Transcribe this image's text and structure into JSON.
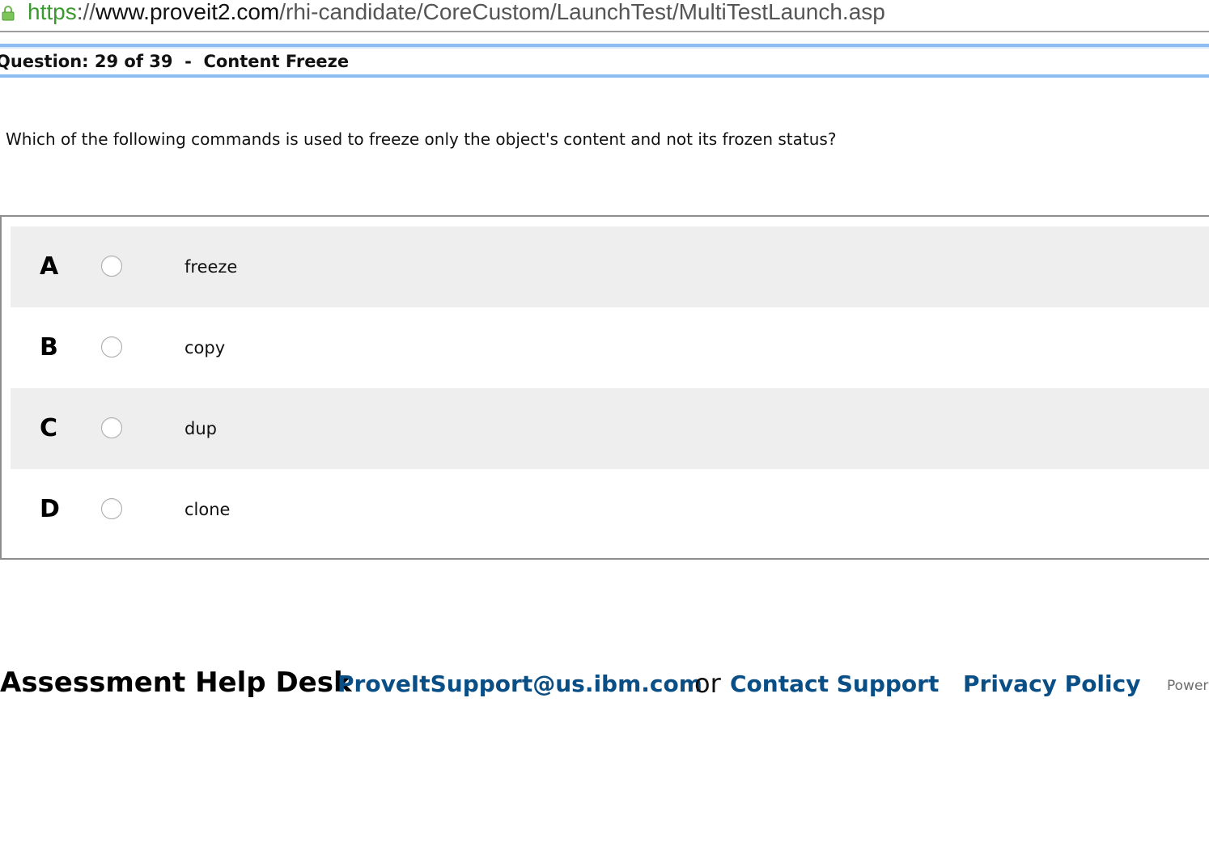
{
  "browser": {
    "url_scheme": "https",
    "url_separator": "://",
    "url_host": "www.proveit2.com",
    "url_path": "/rhi-candidate/CoreCustom/LaunchTest/MultiTestLaunch.asp",
    "secure_icon": "lock-icon",
    "secure_color": "#3a9a2f"
  },
  "header": {
    "title": "Question: 29 of 39  -  Content Freeze",
    "border_color": "#8cbcf2"
  },
  "question": {
    "text": "Which of the following commands is used to freeze only the object's content and not its frozen status?"
  },
  "answers": [
    {
      "letter": "A",
      "text": "freeze",
      "selected": false
    },
    {
      "letter": "B",
      "text": "copy",
      "selected": false
    },
    {
      "letter": "C",
      "text": "dup",
      "selected": false
    },
    {
      "letter": "D",
      "text": "clone",
      "selected": false
    }
  ],
  "footer": {
    "help_title": "Assessment Help Desk",
    "email_link": "ProveItSupport@us.ibm.com",
    "or_text": "or",
    "contact_link": "Contact Support",
    "privacy_link": "Privacy Policy",
    "powered_text": "Power",
    "link_color": "#0a4e86"
  }
}
